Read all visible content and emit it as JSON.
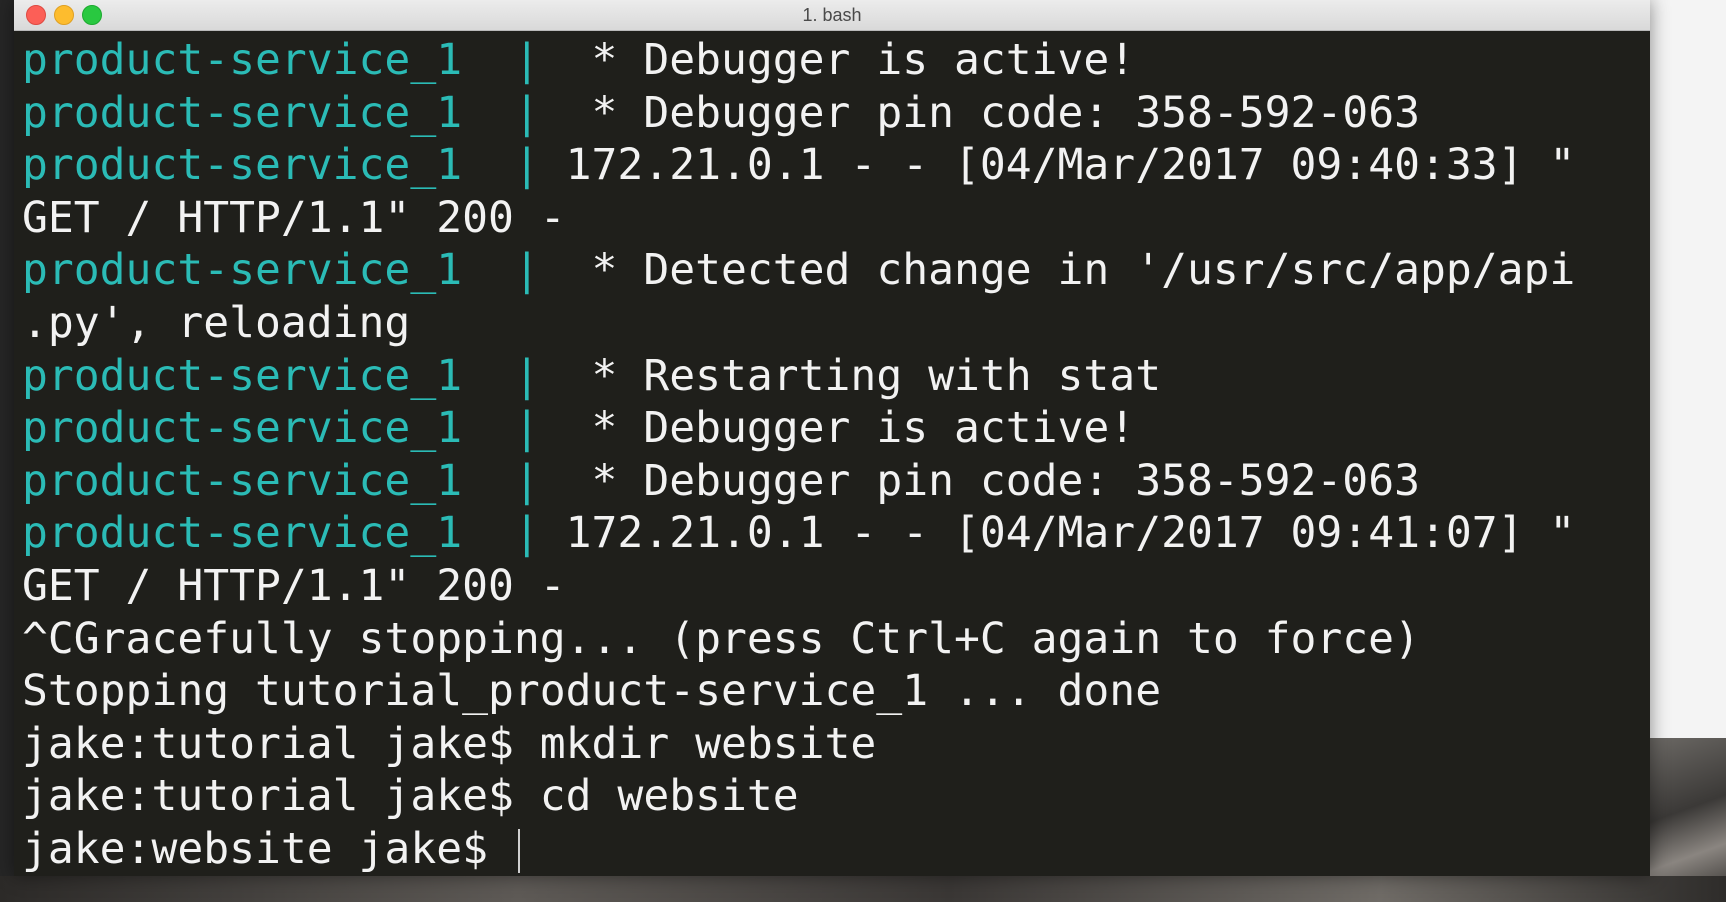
{
  "window": {
    "title": "1. bash"
  },
  "colors": {
    "terminal_bg": "#1f1f1b",
    "text": "#f2f2f2",
    "service_prefix": "#2bbbb6"
  },
  "terminal": {
    "lines": [
      {
        "prefix": "product-service_1  |  ",
        "text": "* Debugger is active!"
      },
      {
        "prefix": "product-service_1  |  ",
        "text": "* Debugger pin code: 358-592-063"
      },
      {
        "prefix": "product-service_1  | ",
        "text": "172.21.0.1 - - [04/Mar/2017 09:40:33] \""
      },
      {
        "prefix": "",
        "text": "GET / HTTP/1.1\" 200 -"
      },
      {
        "prefix": "product-service_1  |  ",
        "text": "* Detected change in '/usr/src/app/api"
      },
      {
        "prefix": "",
        "text": ".py', reloading"
      },
      {
        "prefix": "product-service_1  |  ",
        "text": "* Restarting with stat"
      },
      {
        "prefix": "product-service_1  |  ",
        "text": "* Debugger is active!"
      },
      {
        "prefix": "product-service_1  |  ",
        "text": "* Debugger pin code: 358-592-063"
      },
      {
        "prefix": "product-service_1  | ",
        "text": "172.21.0.1 - - [04/Mar/2017 09:41:07] \""
      },
      {
        "prefix": "",
        "text": "GET / HTTP/1.1\" 200 -"
      },
      {
        "prefix": "",
        "text": "^CGracefully stopping... (press Ctrl+C again to force)"
      },
      {
        "prefix": "",
        "text": "Stopping tutorial_product-service_1 ... done"
      },
      {
        "prefix": "",
        "text": "jake:tutorial jake$ mkdir website"
      },
      {
        "prefix": "",
        "text": "jake:tutorial jake$ cd website"
      },
      {
        "prefix": "",
        "text": "jake:website jake$ "
      }
    ]
  }
}
